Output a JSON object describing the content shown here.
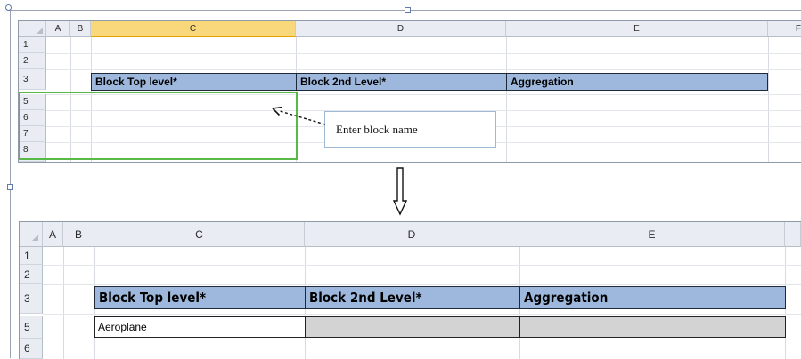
{
  "top_sheet": {
    "columns": [
      "A",
      "B",
      "C",
      "D",
      "E",
      "F"
    ],
    "rows": [
      "1",
      "2",
      "3",
      "5",
      "6",
      "7",
      "8"
    ],
    "header_row": {
      "c": "Block Top level*",
      "d": "Block 2nd Level*",
      "e": "Aggregation"
    },
    "callout_text": "Enter block name"
  },
  "bottom_sheet": {
    "columns": [
      "A",
      "B",
      "C",
      "D",
      "E"
    ],
    "rows": [
      "1",
      "2",
      "3",
      "5",
      "6"
    ],
    "header_row": {
      "c": "Block Top level*",
      "d": "Block 2nd Level*",
      "e": "Aggregation"
    },
    "row5_c_value": "Aeroplane"
  },
  "icons": {
    "down_arrow": "⇩",
    "dashed_arrow": "dashed-arrow-left"
  },
  "colors": {
    "band_blue": "#9db8dc",
    "selected_header": "#f9d77b",
    "green_outline": "#58b947",
    "gray_fill": "#d3d3d3"
  }
}
